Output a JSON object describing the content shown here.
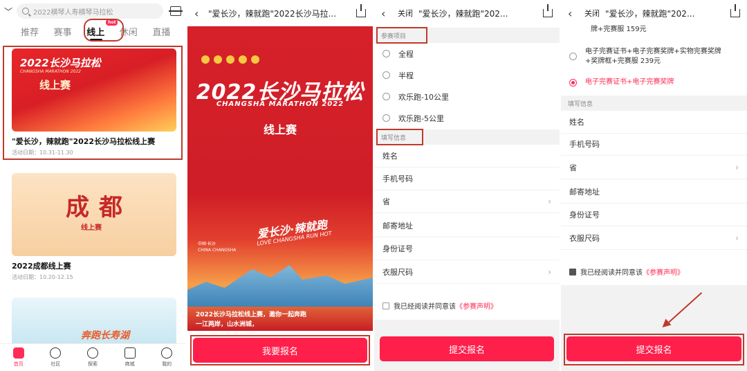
{
  "colors": {
    "accent": "#ff1f4b",
    "annotation_red": "#c0392b",
    "poster_red": "#d6202a"
  },
  "p1": {
    "search_placeholder": "2022横琴人寿横琴马拉松",
    "tabs": [
      "推荐",
      "赛事",
      "线上",
      "休闲",
      "直播"
    ],
    "hot_badge": "hot",
    "cards": [
      {
        "banner_title": "2022长沙马拉松",
        "banner_sub": "CHANGSHA MARATHON 2022",
        "banner_tag": "线上赛",
        "title": "\"爱长沙，辣就跑\"2022长沙马拉松线上赛",
        "date": "活动日期：10.31-11.30"
      },
      {
        "banner_title": "成都",
        "banner_tag": "线上赛",
        "title": "2022成都线上赛",
        "date": "活动日期：10.20-12.15"
      },
      {
        "banner_title": "奔跑长寿湖",
        "title": "",
        "date": ""
      }
    ],
    "nav": [
      "首页",
      "社区",
      "探索",
      "商城",
      "我的"
    ]
  },
  "p2": {
    "back_icon": "‹",
    "title": "\"爱长沙，辣就跑\"2022长沙马拉...",
    "poster_title": "2022长沙马拉松",
    "poster_en": "CHANGSHA MARATHON 2022",
    "poster_online": "线上赛",
    "poster_slogan": "爱长沙·辣就跑",
    "poster_slogan_en": "LOVE CHANGSHA RUN HOT",
    "poster_city": "中国·长沙",
    "poster_city_en": "CHINA  CHANGSHA",
    "poster_footer_1": "2022长沙马拉松线上赛，邀你一起奔跑",
    "poster_footer_2": "一江两岸，山水洲城，",
    "button": "我要报名"
  },
  "p3": {
    "close": "关闭",
    "title": "\"爱长沙，辣就跑\"202...",
    "section_event": "参赛项目",
    "events": [
      "全程",
      "半程",
      "欢乐跑-10公里",
      "欢乐跑-5公里"
    ],
    "section_info": "填写信息",
    "fields": [
      "姓名",
      "手机号码",
      "省",
      "邮寄地址",
      "身份证号",
      "衣服尺码"
    ],
    "agree_text": "我已经阅读并同意该",
    "agree_link": "《参赛声明》",
    "button": "提交报名"
  },
  "p4": {
    "close": "关闭",
    "title": "\"爱长沙，辣就跑\"202...",
    "options": [
      {
        "text": "牌+完赛服 159元",
        "checked": false
      },
      {
        "text": "电子完赛证书+电子完赛奖牌+实物完赛奖牌+奖牌框+完赛服 239元",
        "checked": false
      },
      {
        "text": "电子完赛证书+电子完赛奖牌",
        "checked": true
      }
    ],
    "section_info": "填写信息",
    "fields": [
      "姓名",
      "手机号码",
      "省",
      "邮寄地址",
      "身份证号",
      "衣服尺码"
    ],
    "agree_text": "我已经阅读并同意该",
    "agree_link": "《参赛声明》",
    "button": "提交报名"
  }
}
